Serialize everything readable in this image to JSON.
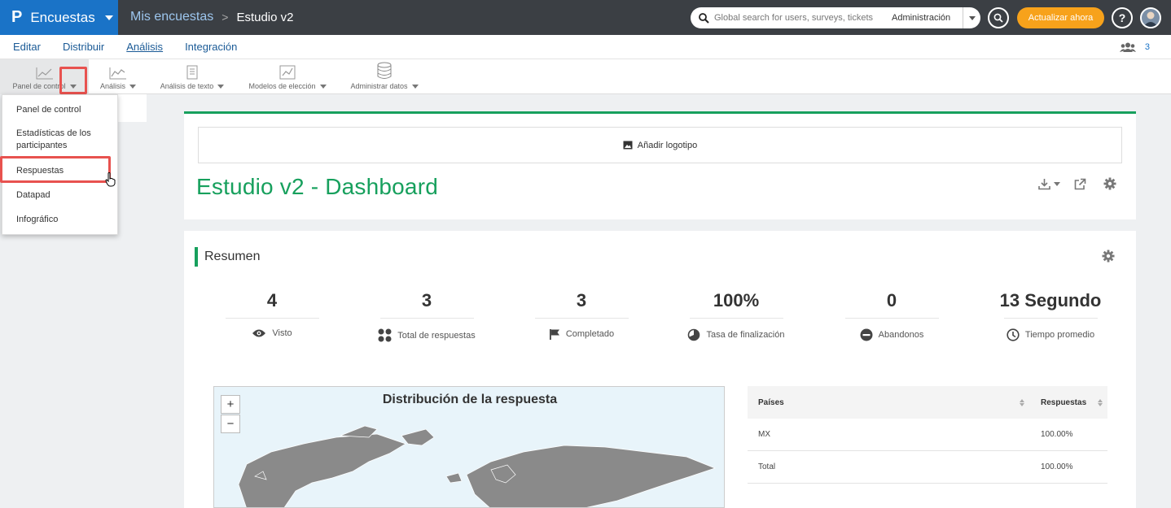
{
  "brand": {
    "logo": "P",
    "name": "Encuestas"
  },
  "breadcrumb": {
    "parent": "Mis encuestas",
    "separator": ">",
    "current": "Estudio v2"
  },
  "search": {
    "placeholder": "Global search for users, surveys, tickets",
    "scope": "Administración"
  },
  "header": {
    "upgrade_label": "Actualizar ahora",
    "help_label": "?"
  },
  "main_nav": {
    "tabs": [
      {
        "label": "Editar"
      },
      {
        "label": "Distribuir"
      },
      {
        "label": "Análisis"
      },
      {
        "label": "Integración"
      }
    ],
    "active": "Análisis",
    "collaborators": "3"
  },
  "toolbar": {
    "items": [
      {
        "label": "Panel de control"
      },
      {
        "label": "Análisis"
      },
      {
        "label": "Análisis de texto"
      },
      {
        "label": "Modelos de elección"
      },
      {
        "label": "Administrar datos"
      }
    ]
  },
  "dropdown": {
    "items": [
      {
        "label": "Panel de control"
      },
      {
        "label": "Estadísticas de los participantes"
      },
      {
        "label": "Respuestas"
      },
      {
        "label": "Datapad"
      },
      {
        "label": "Infográfico"
      }
    ],
    "highlighted": "Respuestas"
  },
  "dashboard": {
    "add_logo_label": "Añadir logotipo",
    "title": "Estudio v2 - Dashboard"
  },
  "summary": {
    "title": "Resumen",
    "stats": [
      {
        "value": "4",
        "label": "Visto",
        "icon": "eye-icon"
      },
      {
        "value": "3",
        "label": "Total de respuestas",
        "icon": "dots-grid-icon"
      },
      {
        "value": "3",
        "label": "Completado",
        "icon": "flag-icon"
      },
      {
        "value": "100%",
        "label": "Tasa de finalización",
        "icon": "pie-icon"
      },
      {
        "value": "0",
        "label": "Abandonos",
        "icon": "minus-circle-icon"
      },
      {
        "value": "13 Segundo",
        "label": "Tiempo promedio",
        "icon": "clock-icon"
      }
    ]
  },
  "map": {
    "title": "Distribución de la respuesta",
    "zoom_in": "+",
    "zoom_out": "−"
  },
  "country_table": {
    "columns": [
      "Países",
      "Respuestas"
    ],
    "rows": [
      {
        "country": "MX",
        "responses": "100.00%"
      },
      {
        "country": "Total",
        "responses": "100.00%"
      }
    ]
  },
  "colors": {
    "brand_blue": "#1a73c7",
    "accent_green": "#17a05d",
    "upgrade_orange": "#f7a21b",
    "highlight_red": "#e8524f"
  }
}
